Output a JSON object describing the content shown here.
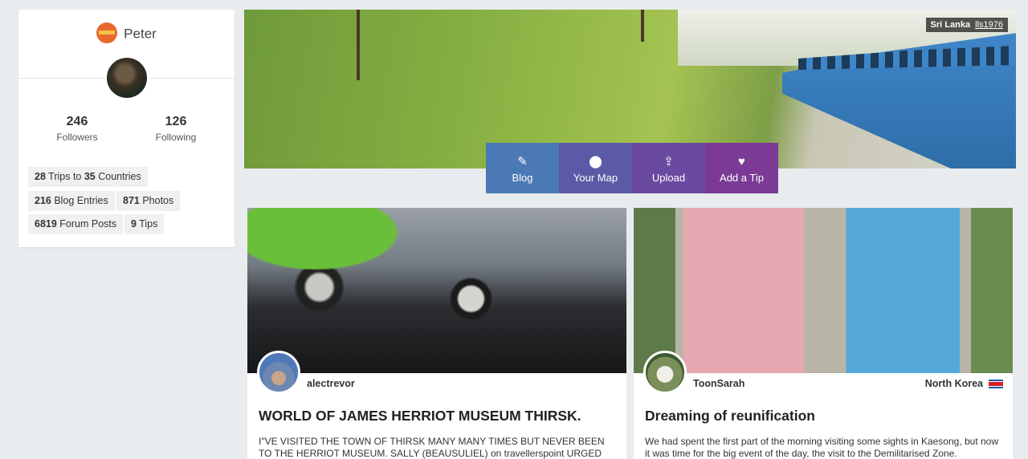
{
  "profile": {
    "username": "Peter",
    "followers": {
      "count": "246",
      "label": "Followers"
    },
    "following": {
      "count": "126",
      "label": "Following"
    },
    "chips": {
      "trips": {
        "n1": "28",
        "t1": " Trips to ",
        "n2": "35",
        "t2": " Countries"
      },
      "blog": {
        "n": "216",
        "t": " Blog Entries"
      },
      "photos": {
        "n": "871",
        "t": " Photos"
      },
      "forum": {
        "n": "6819",
        "t": " Forum Posts"
      },
      "tips": {
        "n": "9",
        "t": " Tips"
      }
    }
  },
  "hero": {
    "location": "Sri Lanka",
    "photographer": "lls1976"
  },
  "actions": [
    {
      "label": "Blog",
      "icon": "pencil-icon",
      "color": "#4a79b5"
    },
    {
      "label": "Your Map",
      "icon": "map-pin-icon",
      "color": "#5a5aa6"
    },
    {
      "label": "Upload",
      "icon": "upload-icon",
      "color": "#6a4aa0"
    },
    {
      "label": "Add a Tip",
      "icon": "heart-icon",
      "color": "#7a3a96"
    }
  ],
  "cards": [
    {
      "user": "alectrevor",
      "country": "",
      "title": "WORLD OF JAMES HERRIOT MUSEUM THIRSK.",
      "excerpt": "I\"VE VISITED THE TOWN OF THIRSK MANY MANY TIMES BUT NEVER BEEN TO THE HERRIOT MUSEUM. SALLY (BEAUSULIEL) on travellerspoint URGED ME TO VISIT IT."
    },
    {
      "user": "ToonSarah",
      "country": "North Korea",
      "title": "Dreaming of reunification",
      "excerpt": "We had spent the first part of the morning visiting some sights in Kaesong, but now it was time for the big event of the day, the visit to the Demilitarised Zone."
    }
  ]
}
